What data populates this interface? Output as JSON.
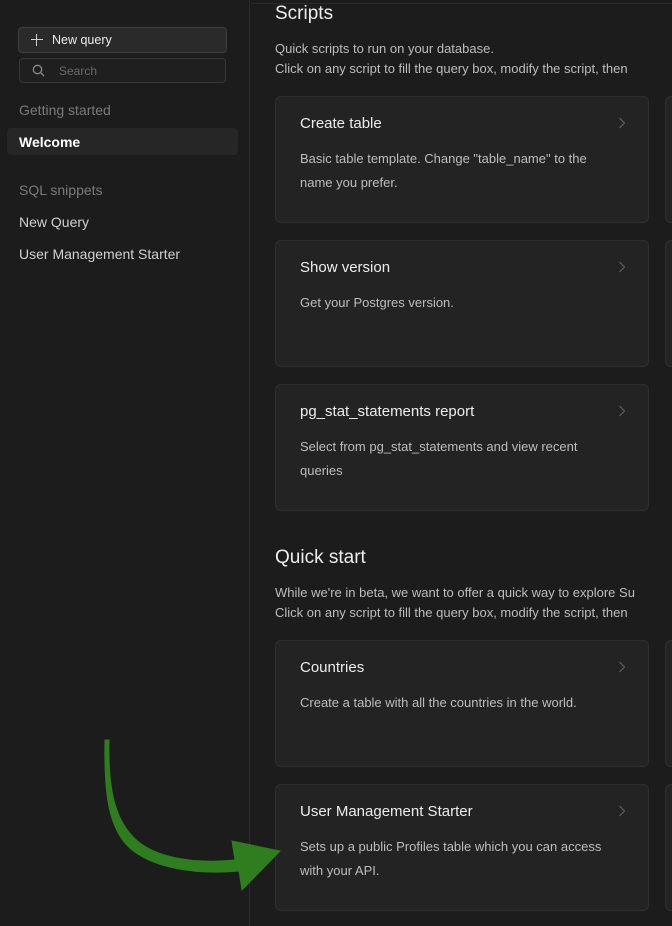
{
  "sidebar": {
    "new_query_label": "New query",
    "search_placeholder": "Search",
    "getting_started_label": "Getting started",
    "welcome_label": "Welcome",
    "sql_snippets_label": "SQL snippets",
    "items": [
      {
        "label": "New Query"
      },
      {
        "label": "User Management Starter"
      }
    ]
  },
  "scripts": {
    "title": "Scripts",
    "desc_line1": "Quick scripts to run on your database.",
    "desc_line2": "Click on any script to fill the query box, modify the script, then",
    "cards": [
      {
        "title": "Create table",
        "desc": "Basic table template. Change \"table_name\" to the name you prefer."
      },
      {
        "title": "Show version",
        "desc": "Get your Postgres version."
      },
      {
        "title": "pg_stat_statements report",
        "desc": "Select from pg_stat_statements and view recent queries"
      }
    ]
  },
  "quickstart": {
    "title": "Quick start",
    "desc_line1": "While we're in beta, we want to offer a quick way to explore Su",
    "desc_line2": "Click on any script to fill the query box, modify the script, then",
    "cards": [
      {
        "title": "Countries",
        "desc": "Create a table with all the countries in the world."
      },
      {
        "title": "User Management Starter",
        "desc": "Sets up a public Profiles table which you can access with your API."
      }
    ]
  },
  "colors": {
    "background": "#1c1c1c",
    "card": "#232323",
    "arrow": "#2e7d1e"
  },
  "icons": [
    "plus-icon",
    "search-icon",
    "chevron-right-icon",
    "arrow-annotation"
  ]
}
